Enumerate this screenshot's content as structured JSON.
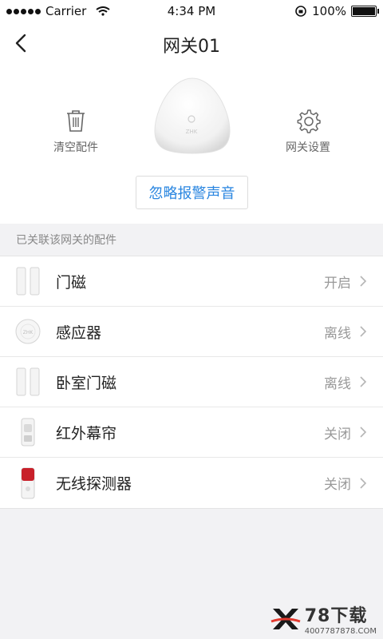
{
  "status_bar": {
    "carrier": "Carrier",
    "time": "4:34 PM",
    "battery": "100%"
  },
  "header": {
    "title": "网关01",
    "clear_label": "清空配件",
    "settings_label": "网关设置",
    "device_logo": "ZHK",
    "ignore_button": "忽略报警声音"
  },
  "section": {
    "title": "已关联该网关的配件"
  },
  "accessories": [
    {
      "name": "门磁",
      "status": "开启",
      "icon": "door-sensor-icon"
    },
    {
      "name": "感应器",
      "status": "离线",
      "icon": "motion-sensor-icon"
    },
    {
      "name": "卧室门磁",
      "status": "离线",
      "icon": "door-sensor-icon"
    },
    {
      "name": "红外幕帘",
      "status": "关闭",
      "icon": "infrared-curtain-icon"
    },
    {
      "name": "无线探测器",
      "status": "关闭",
      "icon": "wireless-detector-icon"
    }
  ],
  "watermark": {
    "main": "78下载",
    "sub": "4007787878.COM"
  },
  "colors": {
    "accent": "#2a86e0",
    "background": "#f2f2f4"
  }
}
